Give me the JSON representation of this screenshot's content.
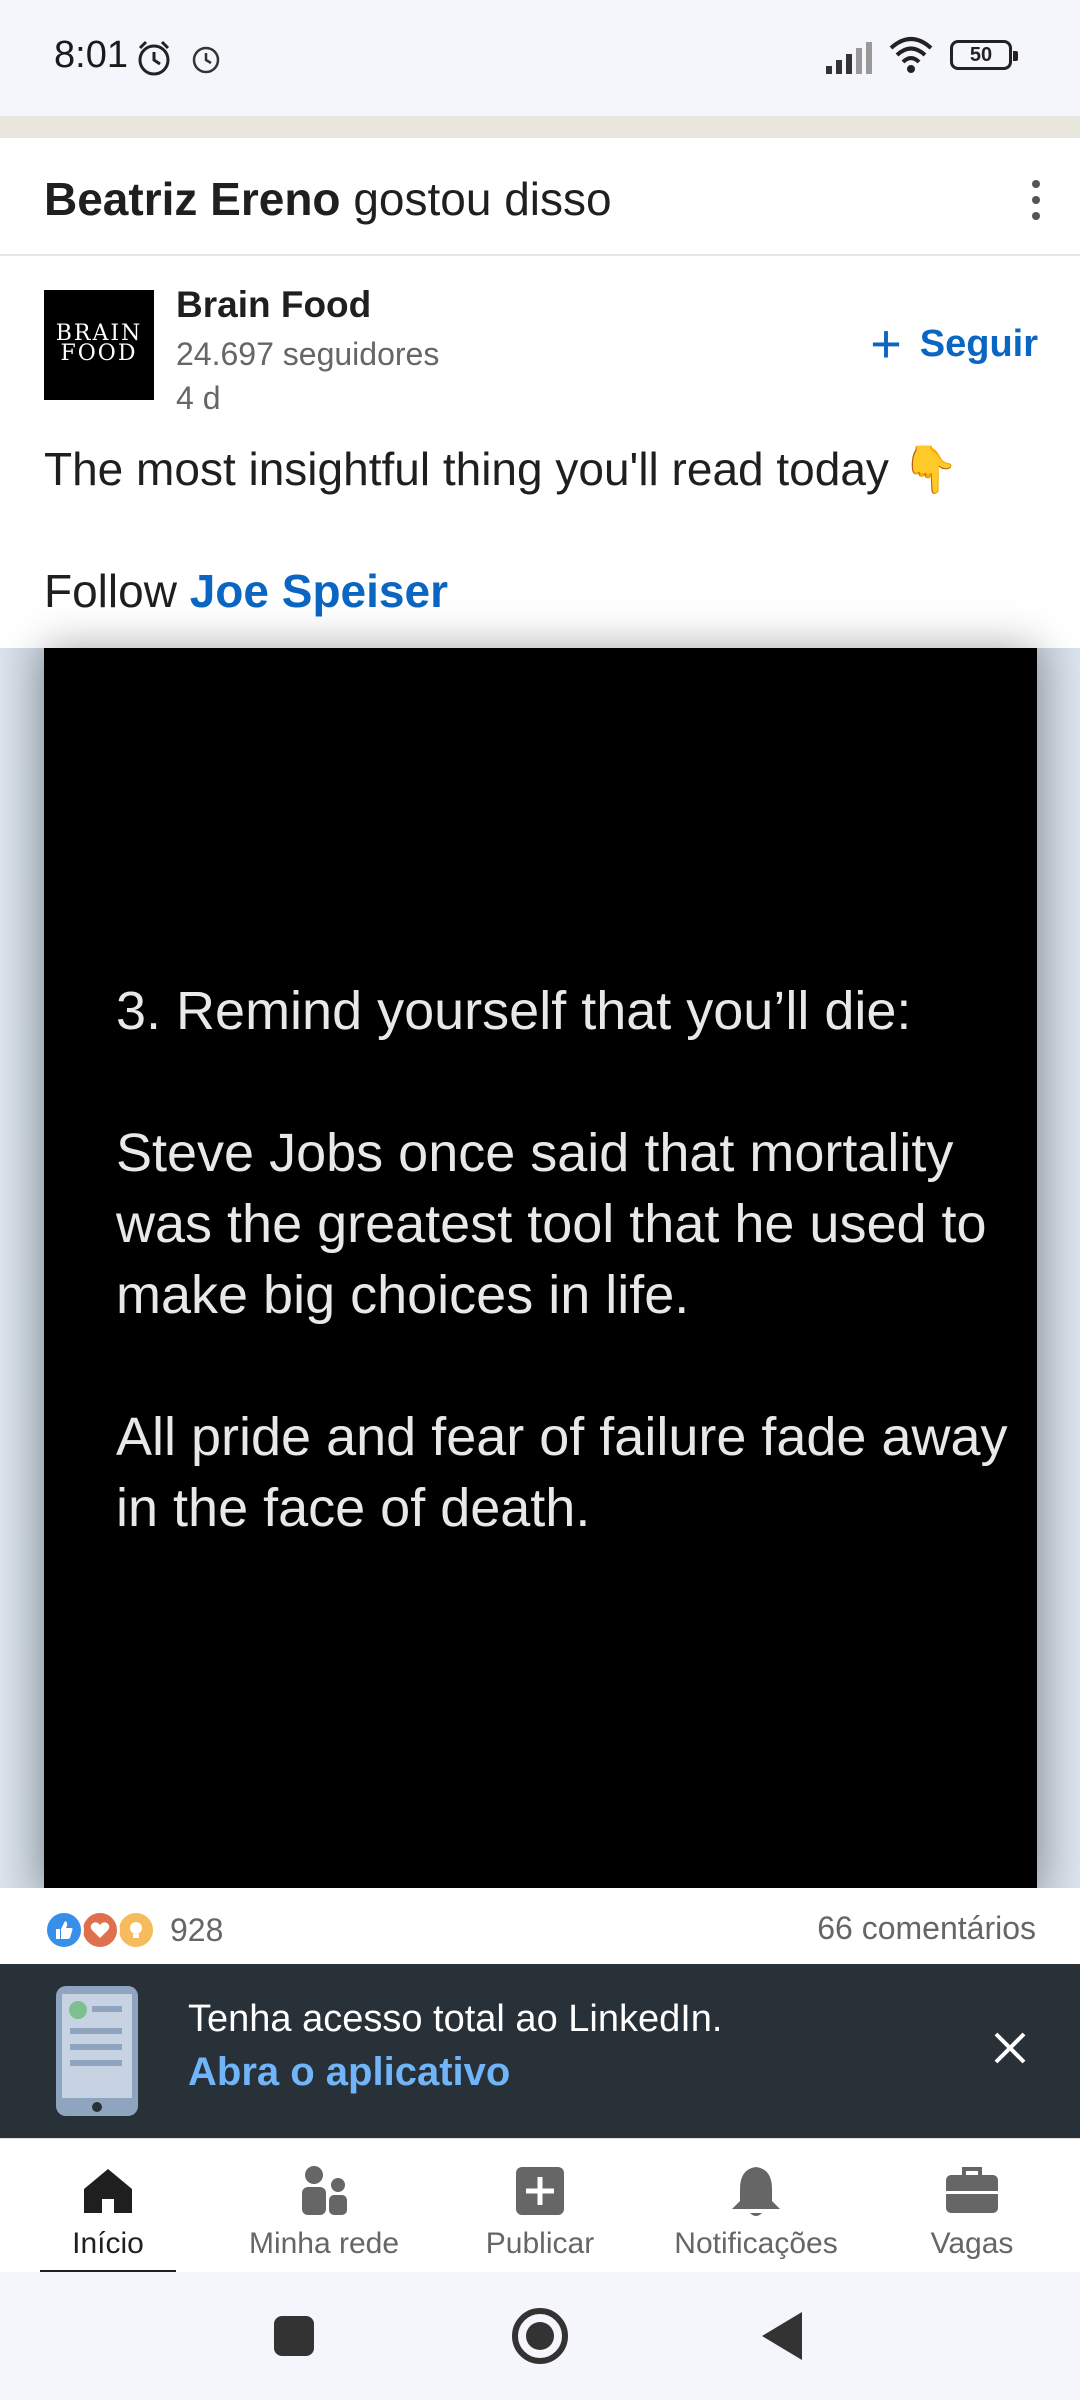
{
  "status_bar": {
    "time": "8:01",
    "battery": "50"
  },
  "notification_header": {
    "actor": "Beatriz Ereno",
    "action": "gostou disso"
  },
  "post": {
    "author_logo_text_1": "BRAIN",
    "author_logo_text_2": "FOOD",
    "author_name": "Brain Food",
    "author_followers": "24.697 seguidores",
    "age": "4 d",
    "follow_label": "Seguir",
    "text": "The most insightful thing you'll read today 👇",
    "follow_prefix": "Follow",
    "follow_link": "Joe Speiser",
    "image_text": {
      "heading": "3. Remind yourself that you’ll die:",
      "paragraph_1": "Steve Jobs once said that mortality was the greatest tool that he used to make big choices in life.",
      "paragraph_2": "All pride and fear of failure fade away in the face of death."
    },
    "reaction_count": "928",
    "comments": "66 comentários"
  },
  "app_banner": {
    "text": "Tenha acesso total ao LinkedIn.",
    "link": "Abra o aplicativo"
  },
  "bottom_nav": {
    "items": [
      {
        "label": "Início",
        "icon": "home-icon",
        "active": true
      },
      {
        "label": "Minha rede",
        "icon": "network-icon"
      },
      {
        "label": "Publicar",
        "icon": "post-icon"
      },
      {
        "label": "Notificações",
        "icon": "bell-icon"
      },
      {
        "label": "Vagas",
        "icon": "briefcase-icon"
      }
    ]
  },
  "colors": {
    "brand_blue": "#0a66c2",
    "banner_link": "#70b5f9",
    "banner_bg": "#283038"
  }
}
